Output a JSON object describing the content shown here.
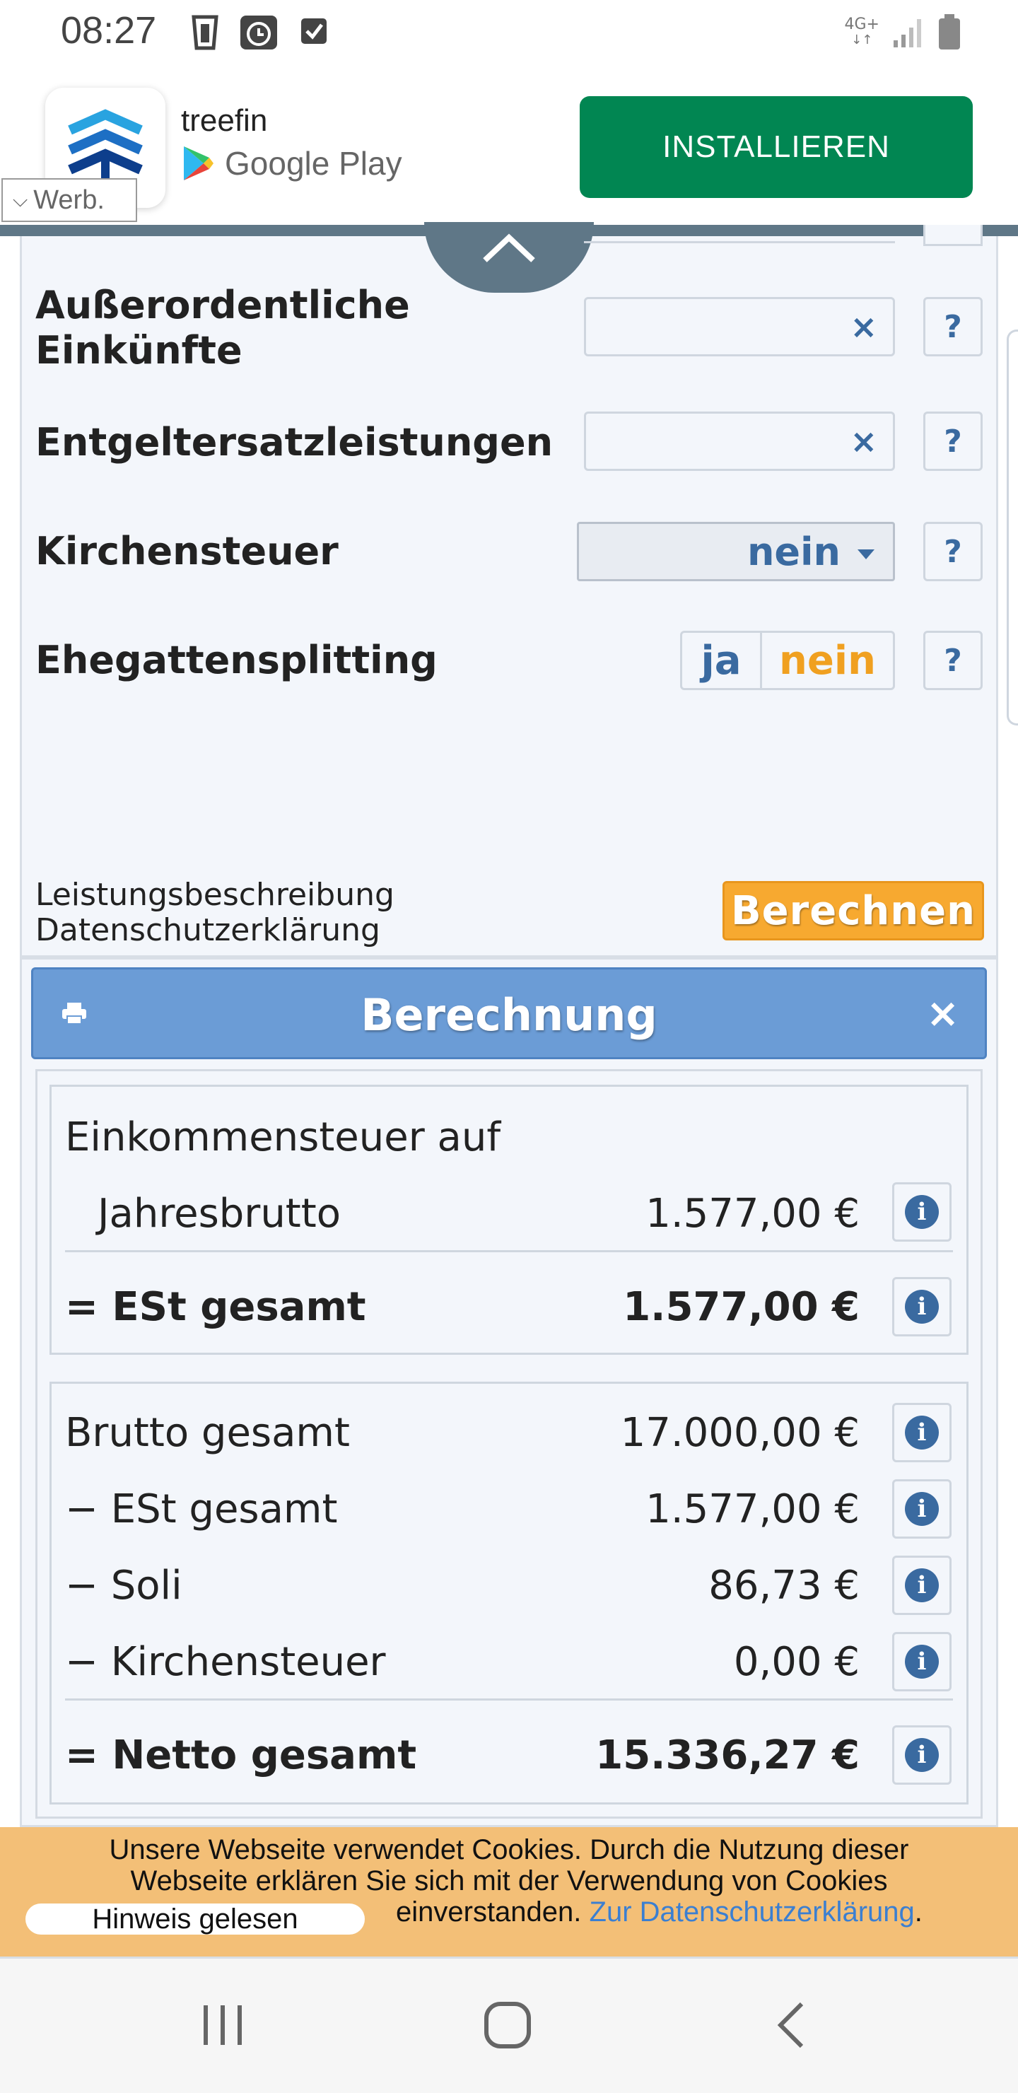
{
  "status_bar": {
    "time": "08:27",
    "network": "4G+"
  },
  "ad": {
    "app_name": "treefin",
    "store": "Google Play",
    "install_label": "INSTALLIEREN",
    "ad_label": "Werb."
  },
  "form": {
    "rows": [
      {
        "label_line1": "Außerordentliche",
        "label_line2": "Einkünfte",
        "value": ""
      },
      {
        "label": "Entgeltersatzleistungen",
        "value": ""
      }
    ],
    "kirchensteuer": {
      "label": "Kirchensteuer",
      "selected": "nein"
    },
    "ehegattensplitting": {
      "label": "Ehegattensplitting",
      "option_yes": "ja",
      "option_no": "nein"
    },
    "help_label": "?",
    "clear_label": "×",
    "footer_links": [
      "Leistungsbeschreibung",
      "Datenschutzerklärung"
    ],
    "calculate_label": "Berechnen"
  },
  "results": {
    "title": "Berechnung",
    "close_label": "×",
    "est_card": {
      "heading": "Einkommensteuer auf",
      "rows": [
        {
          "label": "Jahresbrutto",
          "value": "1.577,00 €"
        }
      ],
      "total": {
        "label": "= ESt gesamt",
        "value": "1.577,00 €"
      }
    },
    "net_card": {
      "rows": [
        {
          "label": "Brutto gesamt",
          "value": "17.000,00 €"
        },
        {
          "label": "− ESt gesamt",
          "value": "1.577,00 €"
        },
        {
          "label": "− Soli",
          "value": "86,73 €"
        },
        {
          "label": "− Kirchensteuer",
          "value": "0,00 €"
        }
      ],
      "total": {
        "label": "= Netto gesamt",
        "value": "15.336,27 €"
      }
    },
    "info_label": "i"
  },
  "cookie": {
    "line1": "Unsere Webseite verwendet Cookies. Durch die Nutzung dieser",
    "line2": "Webseite erklären Sie sich mit der Verwendung von Cookies",
    "line3": "einverstanden.",
    "link": "Zur Datenschutzerklärung",
    "period": ".",
    "button": "Hinweis gelesen"
  },
  "colors": {
    "install_green": "#018652",
    "header_blue": "#6b9cd6",
    "accent_blue": "#3a6aa0",
    "calc_orange": "#f7a930",
    "cookie_bg": "#f3bf77",
    "nein_orange": "#f0a020"
  }
}
